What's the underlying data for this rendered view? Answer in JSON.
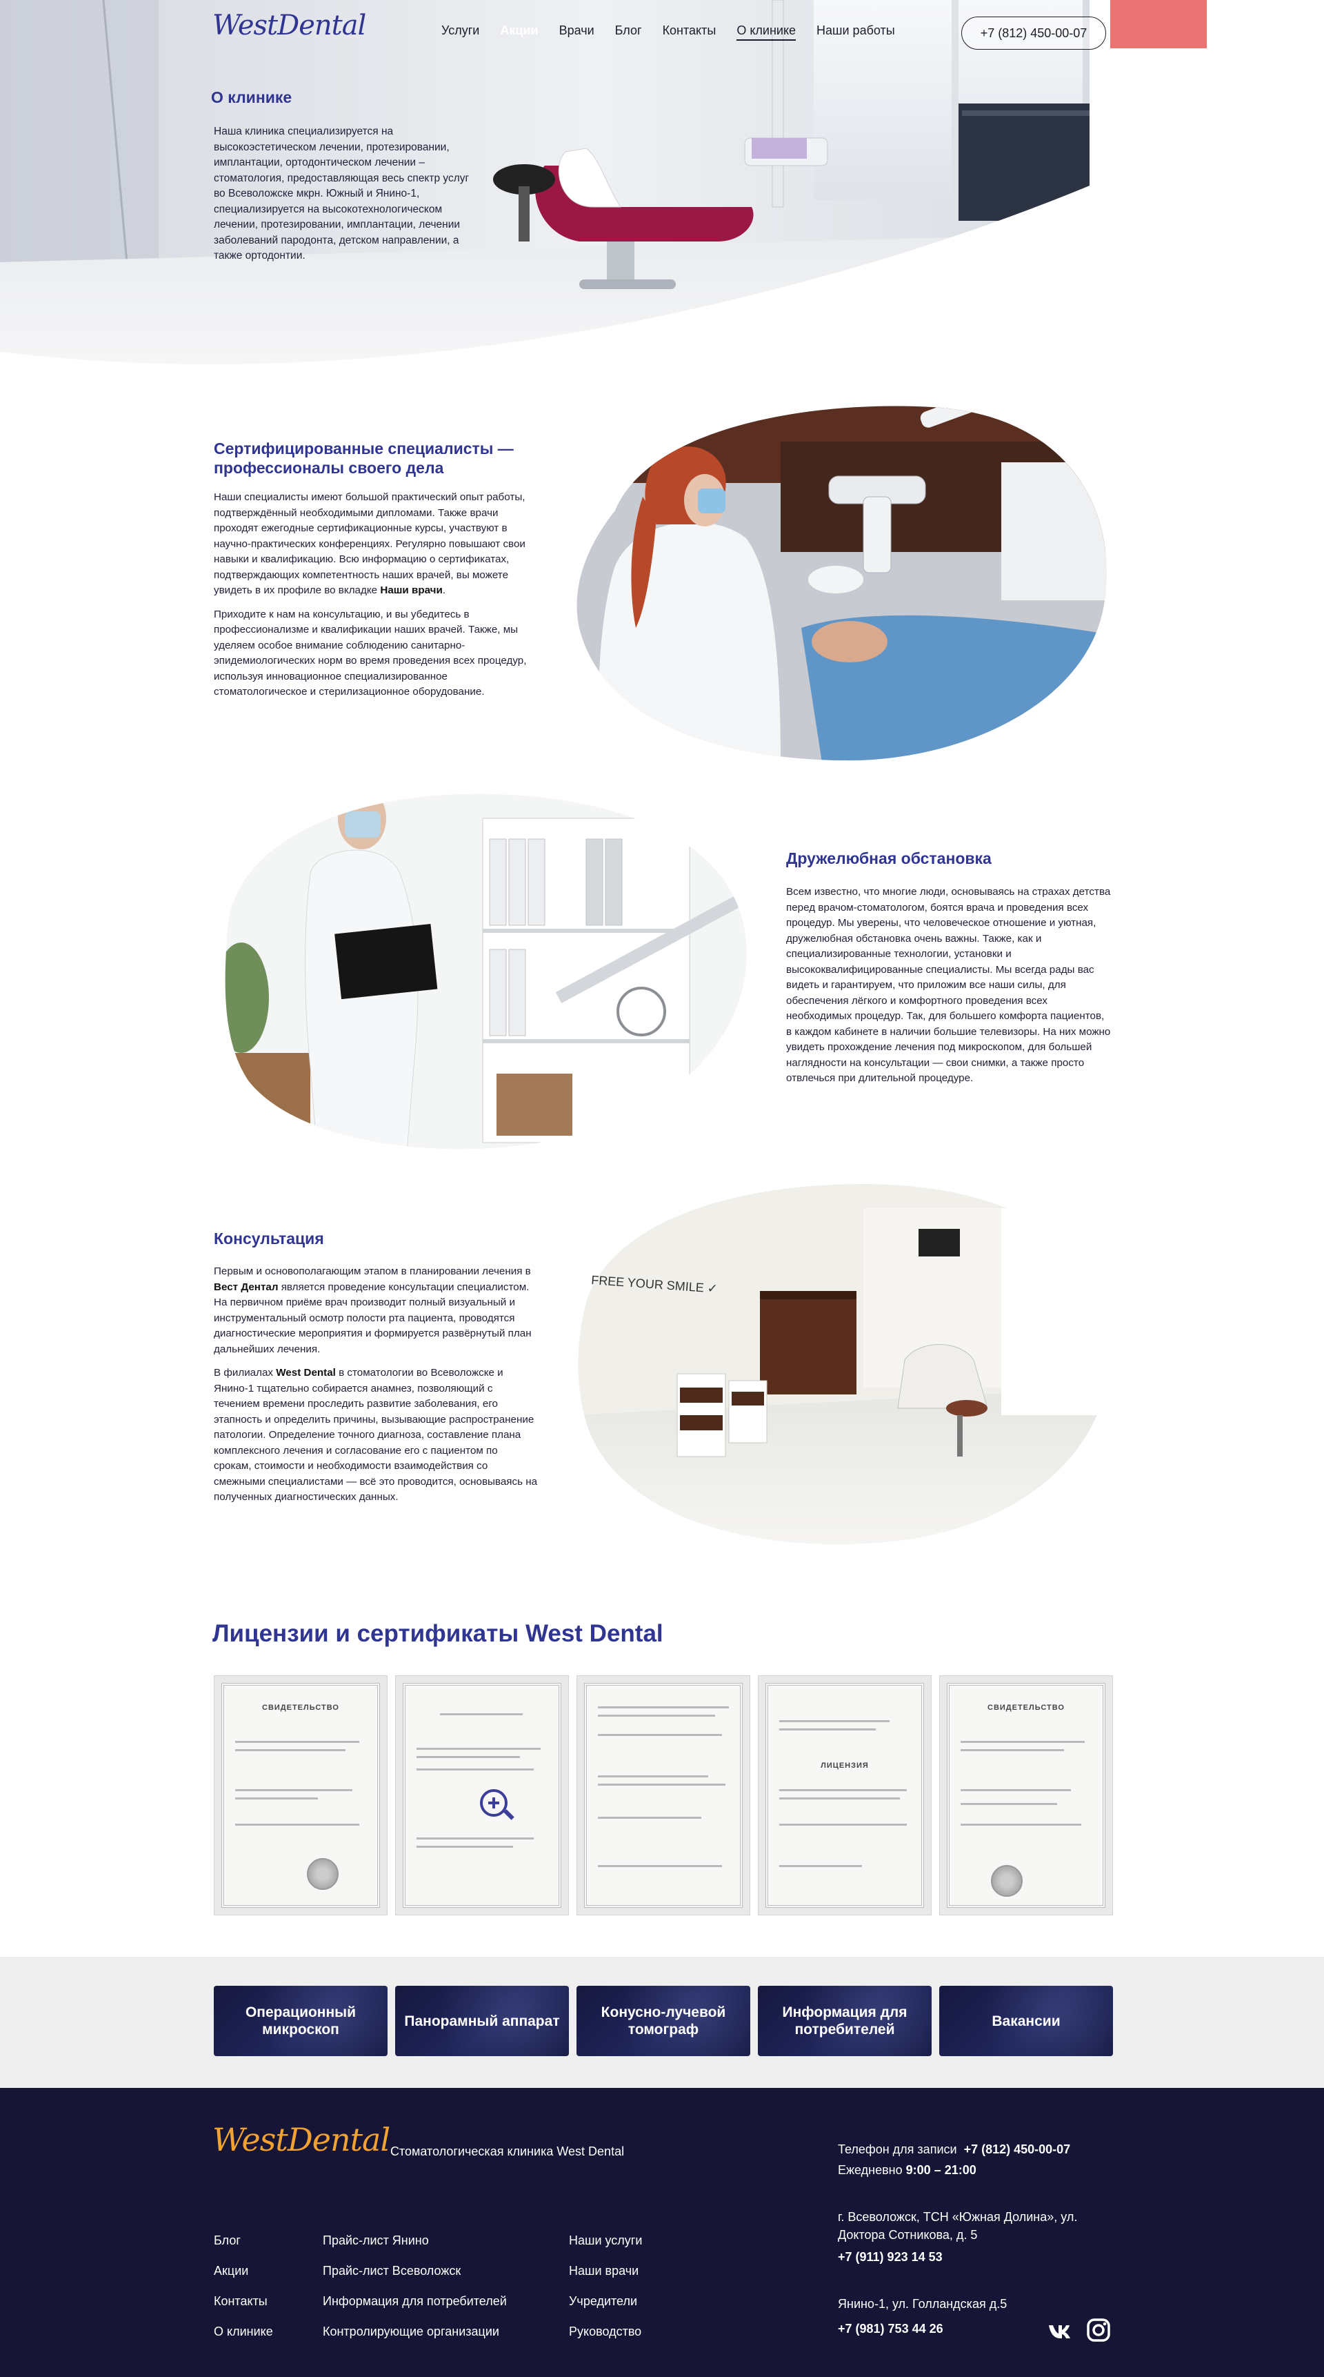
{
  "header": {
    "logo": "WestDental",
    "nav": [
      {
        "label": "Услуги"
      },
      {
        "label": "Акции"
      },
      {
        "label": "Врачи"
      },
      {
        "label": "Блог"
      },
      {
        "label": "Контакты"
      },
      {
        "label": "О клинике"
      },
      {
        "label": "Наши работы"
      }
    ],
    "phone": "+7 (812) 450-00-07"
  },
  "hero": {
    "title": "О клинике",
    "text": "Наша клиника специализируется на высокоэстетическом лечении, протезировании, имплантации, ортодонтическом лечении – стоматология, предоставляющая весь спектр услуг во Всеволожске мкрн. Южный и Янино-1, специализируется на высокотехнологическом лечении, протезировании, имплантации, лечении заболеваний пародонта, детском направлении, а также ортодонтии."
  },
  "sections": [
    {
      "title": "Сертифицированные специалисты — профессионалы своего дела",
      "p1": "Наши специалисты имеют большой практический опыт работы, подтверждённый необходимыми дипломами. Также врачи проходят ежегодные сертификационные курсы, участвуют в научно-практических конференциях. Регулярно повышают свои навыки и квалификацию. Всю информацию о сертификатах, подтверждающих компетентность наших врачей, вы можете увидеть в их профиле во вкладке ",
      "p1_bold": "Наши врачи",
      "p1_end": ".",
      "p2": "Приходите к нам на консультацию, и вы убедитесь в профессионализме и квалификации наших врачей. Также, мы уделяем особое внимание соблюдению санитарно-эпидемиологических норм во время проведения всех процедур, используя инновационное специализированное стоматологическое и стерилизационное оборудование."
    },
    {
      "title": "Дружелюбная обстановка",
      "p1": "Всем известно, что многие люди, основываясь на страхах детства перед врачом-стоматологом, боятся врача и проведения всех процедур. Мы уверены, что человеческое отношение и уютная, дружелюбная обстановка очень важны. Также, как и специализированные технологии, установки и высококвалифицированные специалисты. Мы всегда рады вас видеть и гарантируем, что приложим все наши силы, для обеспечения лёгкого и комфортного проведения всех необходимых процедур. Так, для большего комфорта пациентов, в каждом кабинете в наличии большие телевизоры. На них можно увидеть прохождение лечения под микроскопом, для большей наглядности на консультации — свои снимки, а также просто отвлечься при длительной процедуре."
    },
    {
      "title": "Консультация",
      "p1_start": "Первым и основополагающим этапом в планировании лечения в ",
      "p1_bold": "Вест Дентал",
      "p1_end": " является проведение консультации специалистом. На первичном приёме врач производит полный визуальный и инструментальный осмотр полости рта пациента, проводятся диагностические мероприятия и формируется развёрнутый план дальнейших лечения.",
      "p2_start": "В филиалах ",
      "p2_bold": "West Dental",
      "p2_end": " в стоматологии во Всеволожске и Янино-1 тщательно собирается анамнез, позволяющий с течением времени проследить развитие заболевания, его этапность и определить причины, вызывающие распространение патологии. Определение точного диагноза, составление плана комплексного лечения и согласование его с пациентом по срокам, стоимости и необходимости взаимодействия со смежными специалистами — всё это проводится, основываясь на полученных диагностических данных.",
      "wall_text": "FREE YOUR SMILE ✓"
    }
  ],
  "licenses": {
    "title": "Лицензии и сертификаты West Dental",
    "docs": [
      {
        "heading": "СВИДЕТЕЛЬСТВО"
      },
      {
        "heading": ""
      },
      {
        "heading": ""
      },
      {
        "heading": "ЛИЦЕНЗИЯ"
      },
      {
        "heading": "СВИДЕТЕЛЬСТВО"
      }
    ]
  },
  "tiles": [
    {
      "label": "Операционный микроскоп"
    },
    {
      "label": "Панорамный аппарат"
    },
    {
      "label": "Конусно-лучевой томограф"
    },
    {
      "label": "Информация для потребителей"
    },
    {
      "label": "Вакансии"
    }
  ],
  "footer": {
    "logo": "WestDental",
    "tagline": "Стоматологическая клиника West Dental",
    "col1": [
      "Блог",
      "Акции",
      "Контакты",
      "О клинике"
    ],
    "col2": [
      "Прайс-лист Янино",
      "Прайс-лист Всеволожск",
      "Информация для потребителей",
      "Контролирующие организации"
    ],
    "col3": [
      "Наши услуги",
      "Наши врачи",
      "Учредители",
      "Руководство"
    ],
    "phone_label": "Телефон для записи",
    "phone": "+7 (812) 450-00-07",
    "hours_label": "Ежедневно",
    "hours": "9:00 – 21:00",
    "address1": "г. Всеволожск, ТСН «Южная Долина», ул. Доктора Сотникова, д. 5",
    "phone1": "+7 (911) 923 14 53",
    "address2": "Янино-1, ул. Голландская д.5",
    "phone2": "+7 (981) 753 44 26"
  },
  "colors": {
    "brand_blue": "#2f3591",
    "footer_bg": "#161536",
    "logo_orange": "#f2a233",
    "strip_bg": "#efeff0"
  }
}
